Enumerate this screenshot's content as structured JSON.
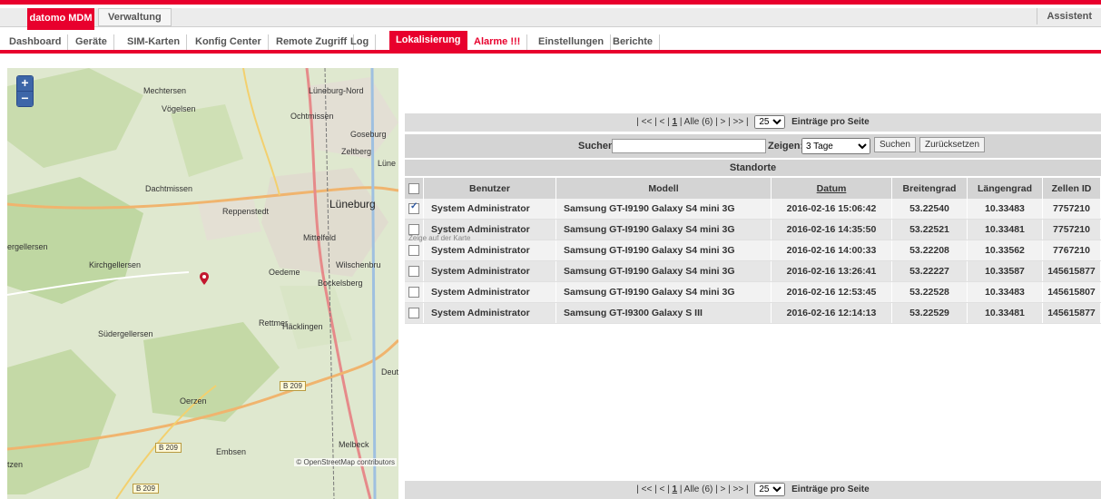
{
  "brand": "datomo MDM",
  "topnav": {
    "verwaltung": "Verwaltung",
    "assistent": "Assistent"
  },
  "tabs": [
    "Dashboard",
    "Geräte",
    "SIM-Karten",
    "Konfig Center",
    "Remote Zugriff",
    "Log",
    "Lokalisierung",
    "Alarme !!!",
    "Einstellungen",
    "Berichte"
  ],
  "active_tab": "Lokalisierung",
  "map": {
    "zoom_in": "+",
    "zoom_out": "−",
    "places": [
      "Mechtersen",
      "Lüneburg-Nord",
      "Vögelsen",
      "Ochtmissen",
      "Goseburg",
      "Zeltberg",
      "Lüne",
      "Dachtmissen",
      "Lüneburg",
      "Reppenstedt",
      "Mittelfeld",
      "ergellersen",
      "Kirchgellersen",
      "Oedeme",
      "Wilschenbru",
      "Bockelsberg",
      "Rettmer",
      "Häcklingen",
      "Südergellersen",
      "Deut",
      "Oerzen",
      "Melbeck",
      "Embsen",
      "tzen"
    ],
    "roads": [
      "B 209",
      "B 209",
      "B 209"
    ],
    "attribution": "© OpenStreetMap contributors"
  },
  "pager": {
    "text_before": "| << | < |",
    "current": "1",
    "text_after": "| Alle (6) | > | >> |",
    "per_page": "25",
    "label": "Einträge pro Seite"
  },
  "search": {
    "label": "Suchen:",
    "value": "",
    "show_label": "Zeigen:",
    "show_value": "3 Tage",
    "search_btn": "Suchen",
    "reset_btn": "Zurücksetzen"
  },
  "section_title": "Standorte",
  "table": {
    "headers": [
      "Benutzer",
      "Modell",
      "Datum",
      "Breitengrad",
      "Längengrad",
      "Zellen ID"
    ],
    "rows": [
      {
        "checked": true,
        "user": "System Administrator",
        "model": "Samsung GT-I9190 Galaxy S4 mini 3G",
        "date": "2016-02-16 15:06:42",
        "lat": "53.22540",
        "lon": "10.33483",
        "cell": "7757210"
      },
      {
        "checked": false,
        "user": "System Administrator",
        "model": "Samsung GT-I9190 Galaxy S4 mini 3G",
        "date": "2016-02-16 14:35:50",
        "lat": "53.22521",
        "lon": "10.33481",
        "cell": "7757210"
      },
      {
        "checked": false,
        "user": "System Administrator",
        "model": "Samsung GT-I9190 Galaxy S4 mini 3G",
        "date": "2016-02-16 14:00:33",
        "lat": "53.22208",
        "lon": "10.33562",
        "cell": "7767210"
      },
      {
        "checked": false,
        "user": "System Administrator",
        "model": "Samsung GT-I9190 Galaxy S4 mini 3G",
        "date": "2016-02-16 13:26:41",
        "lat": "53.22227",
        "lon": "10.33587",
        "cell": "145615877"
      },
      {
        "checked": false,
        "user": "System Administrator",
        "model": "Samsung GT-I9190 Galaxy S4 mini 3G",
        "date": "2016-02-16 12:53:45",
        "lat": "53.22528",
        "lon": "10.33483",
        "cell": "145615807"
      },
      {
        "checked": false,
        "user": "System Administrator",
        "model": "Samsung GT-I9300 Galaxy S III",
        "date": "2016-02-16 12:14:13",
        "lat": "53.22529",
        "lon": "10.33481",
        "cell": "145615877"
      }
    ],
    "row_tooltip": "Zeige auf der Karte"
  },
  "colors": {
    "accent": "#e8002d",
    "header_bg": "#d4d4d4"
  }
}
